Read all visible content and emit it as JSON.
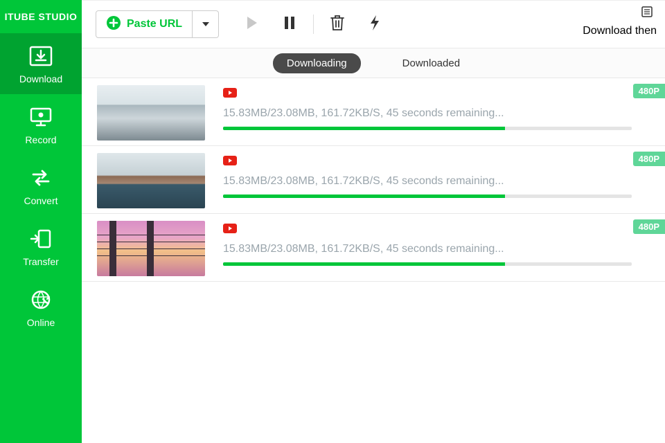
{
  "app": {
    "name": "ITUBE STUDIO"
  },
  "sidebar": {
    "items": [
      {
        "label": "Download"
      },
      {
        "label": "Record"
      },
      {
        "label": "Convert"
      },
      {
        "label": "Transfer"
      },
      {
        "label": "Online"
      }
    ]
  },
  "toolbar": {
    "paste_label": "Paste URL",
    "download_then": "Download then"
  },
  "tabs": {
    "downloading": "Downloading",
    "downloaded": "Downloaded"
  },
  "downloads": [
    {
      "status": "15.83MB/23.08MB, 161.72KB/S, 45 seconds remaining...",
      "badge": "480P",
      "progress": 69
    },
    {
      "status": "15.83MB/23.08MB, 161.72KB/S, 45 seconds remaining...",
      "badge": "480P",
      "progress": 69
    },
    {
      "status": "15.83MB/23.08MB, 161.72KB/S, 45 seconds remaining...",
      "badge": "480P",
      "progress": 69
    }
  ]
}
